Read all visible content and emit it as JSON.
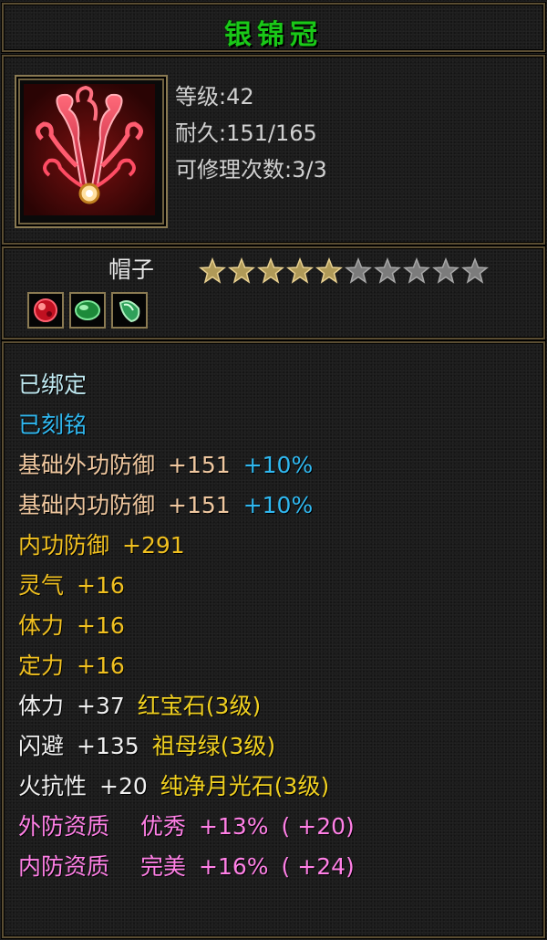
{
  "item": {
    "name": "银锦冠",
    "level_text": "等级:42",
    "durability_text": "耐久:151/165",
    "repair_text": "可修理次数:3/3",
    "slot": "帽子",
    "stars_filled": 5,
    "stars_total": 10,
    "icon": "red-crown-icon",
    "gems": [
      "red-gem-icon",
      "green-gem-icon",
      "green-jade-icon"
    ]
  },
  "attributes": {
    "bound": "已绑定",
    "engraved": "已刻铭",
    "outer_def": {
      "label": "基础外功防御",
      "value": "+151",
      "pct": "+10%"
    },
    "inner_def": {
      "label": "基础内功防御",
      "value": "+151",
      "pct": "+10%"
    },
    "inner_def_bonus": {
      "label": "内功防御",
      "value": "+291"
    },
    "spirit": {
      "label": "灵气",
      "value": "+16"
    },
    "vitality": {
      "label": "体力",
      "value": "+16"
    },
    "focus": {
      "label": "定力",
      "value": "+16"
    },
    "gem1": {
      "label": "体力",
      "value": "+37",
      "gem": "红宝石(3级)"
    },
    "gem2": {
      "label": "闪避",
      "value": "+135",
      "gem": "祖母绿(3级)"
    },
    "gem3": {
      "label": "火抗性",
      "value": "+20",
      "gem": "纯净月光石(3级)"
    },
    "quality_outer": {
      "label": "外防资质",
      "grade": "优秀",
      "value": "+13%",
      "extra": "( +20)"
    },
    "quality_inner": {
      "label": "内防资质",
      "grade": "完美",
      "value": "+16%",
      "extra": "( +24)"
    }
  },
  "colors": {
    "title": "#1ac818",
    "border": "#5a4d32",
    "pink": "#ff80e6",
    "yellow": "#f0c020",
    "blue": "#30b8f0"
  }
}
